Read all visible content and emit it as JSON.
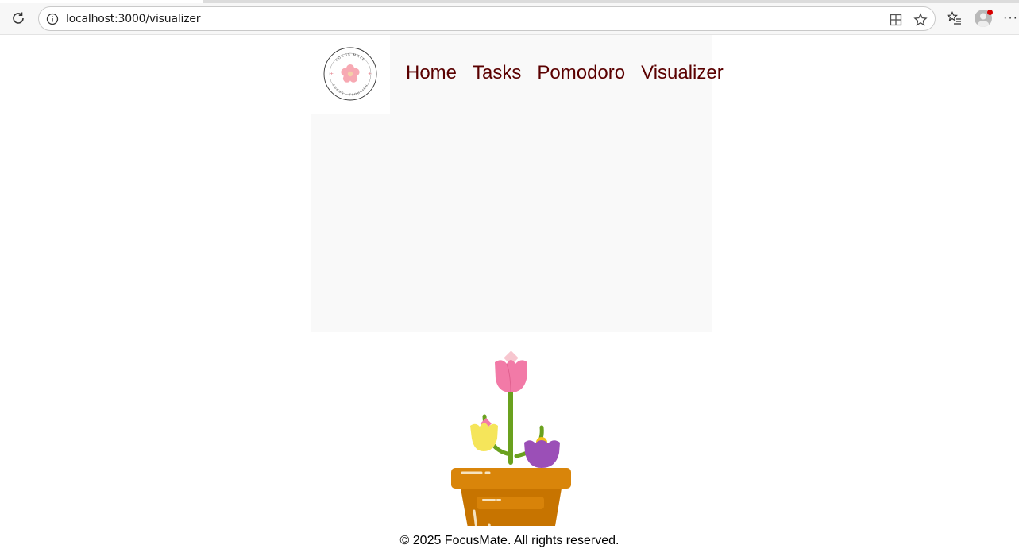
{
  "browser": {
    "url": "localhost:3000/visualizer",
    "icons": {
      "reload": "reload-icon",
      "site_info": "info-icon",
      "app_available": "app-icon",
      "favorite": "star-icon",
      "favorites": "favorites-icon",
      "profile": "avatar",
      "more": "more-icon"
    },
    "more_label": "···"
  },
  "nav": {
    "items": [
      {
        "label": "Home"
      },
      {
        "label": "Tasks"
      },
      {
        "label": "Pomodoro"
      },
      {
        "label": "Visualizer"
      }
    ]
  },
  "logo": {
    "text_top": "FOCUS MATE",
    "text_bottom": "FOCUS · FLOURISH"
  },
  "footer": {
    "text": "© 2025 FocusMate. All rights reserved."
  },
  "colors": {
    "nav_link": "#5a0000",
    "panel": "#f9f9f9",
    "pot": "#c97800",
    "pot_rim": "#d9850a",
    "stem": "#6aa11e",
    "tulip_pink": "#f27aa7",
    "tulip_yellow": "#f5e55a",
    "tulip_purple": "#9b4fb7"
  }
}
